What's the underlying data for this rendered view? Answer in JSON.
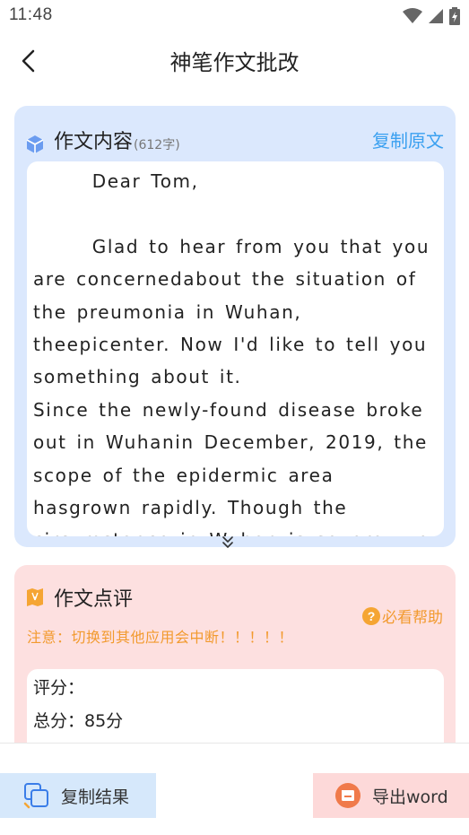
{
  "status_bar": {
    "time": "11:48"
  },
  "header": {
    "title": "神笔作文批改"
  },
  "essay_card": {
    "title": "作文内容",
    "word_count": "(612字)",
    "copy_original_label": "复制原文",
    "text": "      Dear Tom,\n\n      Glad to hear from you that you are concernedabout the situation of the preumonia in Wuhan, theepicenter. Now I'd like to tell you something about it.\nSince the newly-found disease broke out in Wuhanin December, 2019, the scope of the epidermic area hasgrown rapidly. Though the circumstance in Wuhan is severe, we all of the"
  },
  "comment_card": {
    "title": "作文点评",
    "help_label": "必看帮助",
    "notice": "注意：切换到其他应用会中断！！！！！",
    "score_label": "评分：",
    "total_label": "总分：85分"
  },
  "bottom_bar": {
    "copy_result_label": "复制结果",
    "export_label": "导出word"
  },
  "colors": {
    "essay_card_bg": "#dbe8fd",
    "comment_card_bg": "#fde0e0",
    "link_blue": "#3aa0f0",
    "notice_orange": "#f29a2e"
  }
}
